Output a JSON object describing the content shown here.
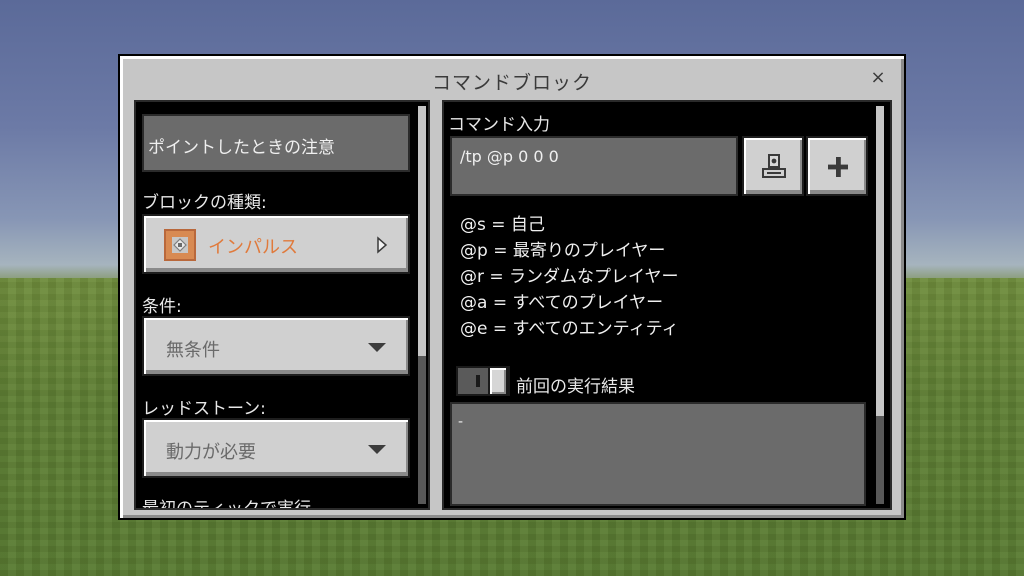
{
  "dialog": {
    "title": "コマンドブロック",
    "close_glyph": "×"
  },
  "left": {
    "hover_note_placeholder": "ポイントしたときの注意",
    "block_type_label": "ブロックの種類:",
    "block_type_value": "インパルス",
    "block_type_color": "#e07a3c",
    "condition_label": "条件:",
    "condition_value": "無条件",
    "redstone_label": "レッドストーン:",
    "redstone_value": "動力が必要",
    "first_tick_label": "最初のティックで実行"
  },
  "right": {
    "command_input_label": "コマンド入力",
    "command_value": "/tp @p 0 0 0",
    "selectors": [
      "@s = 自己",
      "@p = 最寄りのプレイヤー",
      "@r = ランダムなプレイヤー",
      "@a = すべてのプレイヤー",
      "@e = すべてのエンティティ"
    ],
    "previous_output_label": "前回の実行結果",
    "previous_output_value": "-",
    "previous_output_toggle_on": false
  },
  "icons": {
    "command_block": "command-block-icon",
    "chevron_right": "chevron-right-icon",
    "dropdown": "chevron-down-icon",
    "import": "import-icon",
    "add": "plus-icon",
    "close": "close-icon"
  }
}
